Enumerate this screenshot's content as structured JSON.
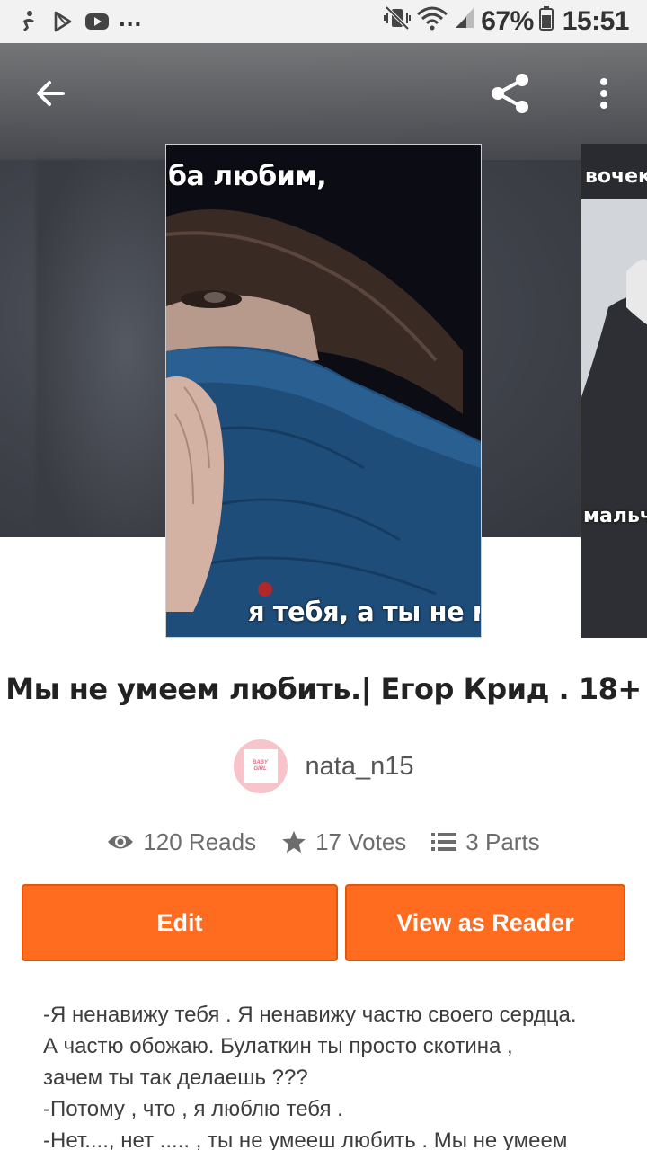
{
  "status_bar": {
    "battery_percent": "67%",
    "time": "15:51",
    "overflow_indicator": "...",
    "left_icons": [
      "accessibility-icon",
      "play-store-icon",
      "youtube-icon"
    ],
    "right_icons": [
      "mute-vibrate-icon",
      "wifi-icon",
      "signal-icon",
      "battery-icon"
    ]
  },
  "header": {
    "back_icon": "arrow-back-icon",
    "share_icon": "share-icon",
    "more_icon": "more-vert-icon"
  },
  "cover": {
    "caption_top": "ба любим,",
    "caption_bottom": "я тебя, а ты не м",
    "next_caption_top": "вочек",
    "next_caption_bottom": "мальч"
  },
  "story": {
    "title": "Мы не умеем любить.| Егор Крид . 18+",
    "author": "nata_n15",
    "avatar_text_line1": "BABY",
    "avatar_text_line2": "GIRL"
  },
  "stats": {
    "reads": "120 Reads",
    "votes": "17 Votes",
    "parts": "3 Parts"
  },
  "actions": {
    "edit_label": "Edit",
    "reader_label": "View as Reader"
  },
  "description": {
    "lines": [
      "-Я ненавижу тебя . Я ненавижу частю своего сердца.",
      "А частю обожаю. Булаткин ты просто скотина ,",
      "зачем ты так делаешь ???",
      "-Потому , что , я люблю тебя .",
      "-Нет...., нет ..... , ты не умееш любить . Мы не умеем"
    ]
  },
  "colors": {
    "accent": "#ff6b1f",
    "accent_border": "#e2560b",
    "title_text": "#222222",
    "meta_text": "#6c6c6c"
  }
}
